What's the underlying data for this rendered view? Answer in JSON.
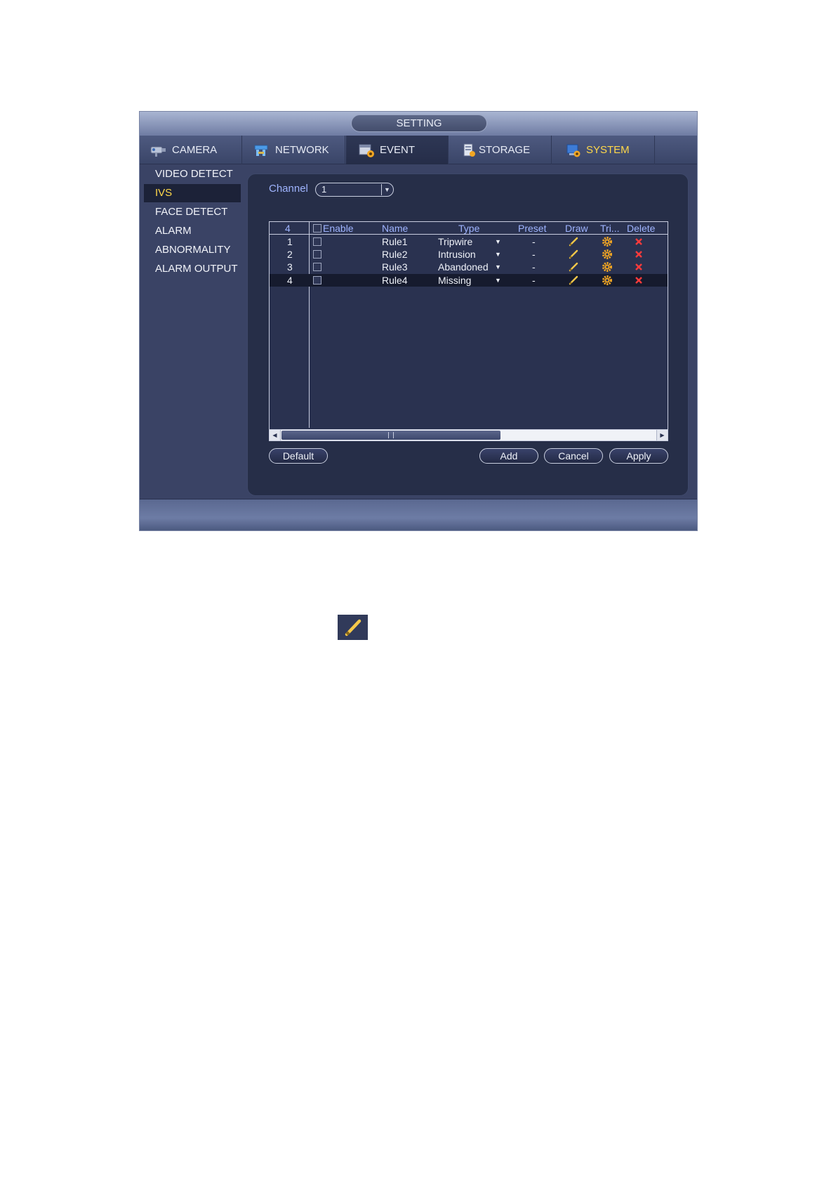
{
  "window": {
    "title": "SETTING"
  },
  "tabs": [
    {
      "label": "CAMERA",
      "icon": "camera-icon"
    },
    {
      "label": "NETWORK",
      "icon": "network-icon"
    },
    {
      "label": "EVENT",
      "icon": "event-icon"
    },
    {
      "label": "STORAGE",
      "icon": "storage-icon"
    },
    {
      "label": "SYSTEM",
      "icon": "system-icon"
    }
  ],
  "sidebar": {
    "items": [
      {
        "label": "VIDEO DETECT"
      },
      {
        "label": "IVS"
      },
      {
        "label": "FACE DETECT"
      },
      {
        "label": "ALARM"
      },
      {
        "label": "ABNORMALITY"
      },
      {
        "label": "ALARM OUTPUT"
      }
    ],
    "selected": "IVS"
  },
  "channel": {
    "label": "Channel",
    "value": "1"
  },
  "table": {
    "headers": {
      "count": "4",
      "enable": "Enable",
      "name": "Name",
      "type": "Type",
      "preset": "Preset",
      "draw": "Draw",
      "trigger": "Tri...",
      "delete": "Delete"
    },
    "rows": [
      {
        "no": "1",
        "name": "Rule1",
        "type": "Tripwire",
        "preset": "-"
      },
      {
        "no": "2",
        "name": "Rule2",
        "type": "Intrusion",
        "preset": "-"
      },
      {
        "no": "3",
        "name": "Rule3",
        "type": "Abandoned",
        "preset": "-"
      },
      {
        "no": "4",
        "name": "Rule4",
        "type": "Missing",
        "preset": "-"
      }
    ],
    "selected_row": "4"
  },
  "buttons": {
    "default": "Default",
    "add": "Add",
    "cancel": "Cancel",
    "apply": "Apply"
  },
  "colors": {
    "accent_yellow": "#ffd84a",
    "label_blue": "#9fb4ff",
    "delete_red": "#ff3b3b",
    "gear_orange": "#f2a623"
  }
}
